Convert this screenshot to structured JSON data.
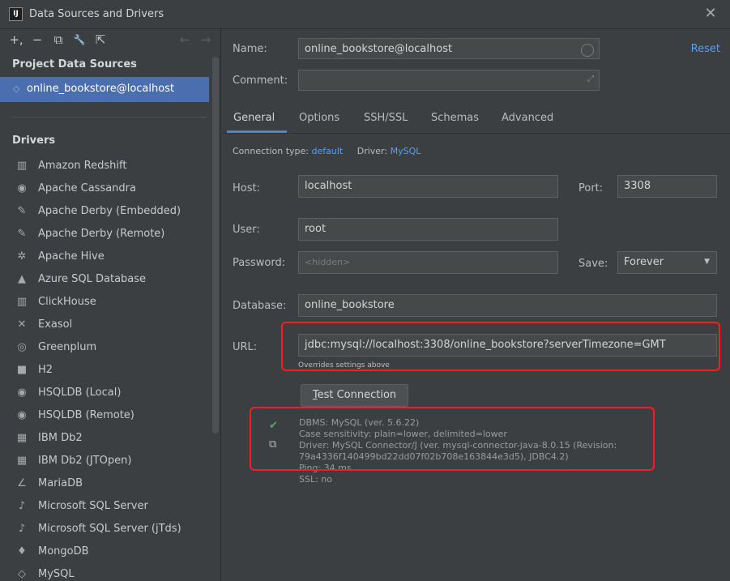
{
  "window": {
    "title": "Data Sources and Drivers",
    "logo_text": "IJ",
    "close_glyph": "✕"
  },
  "toolbar": {
    "add": "+,",
    "remove": "−",
    "duplicate": "⧉",
    "properties": "🔧",
    "make_global": "⇱",
    "back": "←",
    "forward": "→"
  },
  "sidebar": {
    "project_heading": "Project Data Sources",
    "project_item": "online_bookstore@localhost",
    "drivers_heading": "Drivers",
    "drivers": [
      {
        "label": "Amazon Redshift",
        "icon": "▥"
      },
      {
        "label": "Apache Cassandra",
        "icon": "◉"
      },
      {
        "label": "Apache Derby (Embedded)",
        "icon": "✎"
      },
      {
        "label": "Apache Derby (Remote)",
        "icon": "✎"
      },
      {
        "label": "Apache Hive",
        "icon": "✲"
      },
      {
        "label": "Azure SQL Database",
        "icon": "▲"
      },
      {
        "label": "ClickHouse",
        "icon": "▥"
      },
      {
        "label": "Exasol",
        "icon": "✕"
      },
      {
        "label": "Greenplum",
        "icon": "◎"
      },
      {
        "label": "H2",
        "icon": "■"
      },
      {
        "label": "HSQLDB (Local)",
        "icon": "◉"
      },
      {
        "label": "HSQLDB (Remote)",
        "icon": "◉"
      },
      {
        "label": "IBM Db2",
        "icon": "▦"
      },
      {
        "label": "IBM Db2 (JTOpen)",
        "icon": "▦"
      },
      {
        "label": "MariaDB",
        "icon": "∠"
      },
      {
        "label": "Microsoft SQL Server",
        "icon": "♪"
      },
      {
        "label": "Microsoft SQL Server (jTds)",
        "icon": "♪"
      },
      {
        "label": "MongoDB",
        "icon": "♦"
      },
      {
        "label": "MySQL",
        "icon": "◇"
      }
    ]
  },
  "form": {
    "name_label": "Name:",
    "name_value": "online_bookstore@localhost",
    "reset": "Reset",
    "comment_label": "Comment:",
    "comment_value": "",
    "expand_glyph": "⤢",
    "tabs": [
      {
        "label": "General",
        "active": true
      },
      {
        "label": "Options",
        "active": false
      },
      {
        "label": "SSH/SSL",
        "active": false
      },
      {
        "label": "Schemas",
        "active": false
      },
      {
        "label": "Advanced",
        "active": false
      }
    ],
    "conn_type_label": "Connection type:",
    "conn_type_value": "default",
    "driver_label": "Driver:",
    "driver_value": "MySQL",
    "host_label": "Host:",
    "host_value": "localhost",
    "port_label": "Port:",
    "port_value": "3308",
    "user_label": "User:",
    "user_value": "root",
    "password_label": "Password:",
    "password_placeholder": "<hidden>",
    "save_label": "Save:",
    "save_value": "Forever",
    "database_label": "Database:",
    "database_value": "online_bookstore",
    "url_label": "URL:",
    "url_value": "jdbc:mysql://localhost:3308/online_bookstore?serverTimezone=GMT",
    "overrides_note": "Overrides settings above",
    "test_button_mnemonic": "T",
    "test_button_rest": "est Connection"
  },
  "result": {
    "lines": [
      "DBMS: MySQL (ver. 5.6.22)",
      "Case sensitivity: plain=lower, delimited=lower",
      "Driver: MySQL Connector/J (ver. mysql-connector-java-8.0.15 (Revision:",
      "79a4336f140499bd22dd07f02b708e163844e3d5), JDBC4.2)",
      "Ping: 34 ms",
      "SSL: no"
    ],
    "check_glyph": "✔",
    "copy_glyph": "⧉"
  },
  "colors": {
    "background": "#3c3f41",
    "selection": "#4b6eaf",
    "link": "#589df6",
    "success": "#59a869",
    "highlight_box": "#ff1a1a"
  }
}
